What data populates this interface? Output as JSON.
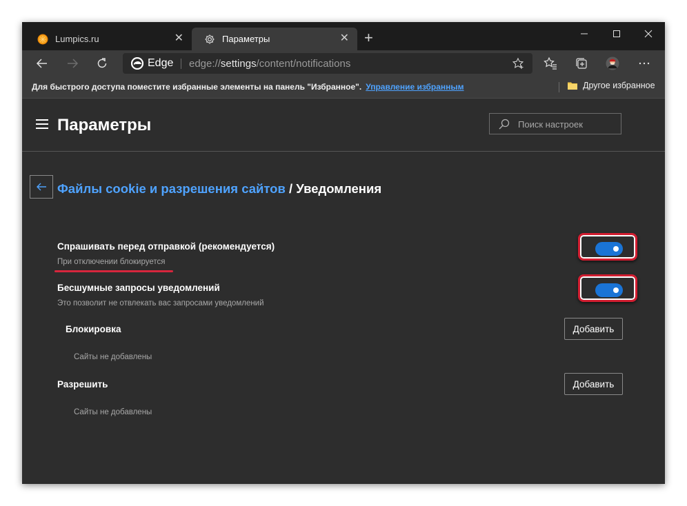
{
  "tabs": [
    {
      "label": "Lumpics.ru",
      "active": false
    },
    {
      "label": "Параметры",
      "active": true
    }
  ],
  "address": {
    "browser_label": "Edge",
    "url_scheme": "edge://",
    "url_host": "settings",
    "url_path": "/content/notifications"
  },
  "favorites_bar": {
    "hint": "Для быстрого доступа поместите избранные элементы на панель \"Избранное\".",
    "manage_link": "Управление избранным",
    "other_favorites": "Другое избранное"
  },
  "settings": {
    "title": "Параметры",
    "search_placeholder": "Поиск настроек"
  },
  "breadcrumb": {
    "parent": "Файлы cookie и разрешения сайтов",
    "separator": " / ",
    "current": "Уведомления"
  },
  "options": [
    {
      "title": "Спрашивать перед отправкой (рекомендуется)",
      "description": "При отключении блокируется",
      "enabled": true
    },
    {
      "title": "Бесшумные запросы уведомлений",
      "description": "Это позволит не отвлекать вас запросами уведомлений",
      "enabled": true
    }
  ],
  "sections": [
    {
      "title": "Блокировка",
      "button": "Добавить",
      "empty_text": "Сайты не добавлены"
    },
    {
      "title": "Разрешить",
      "button": "Добавить",
      "empty_text": "Сайты не добавлены"
    }
  ],
  "colors": {
    "accent": "#1a74d6",
    "link": "#4fa3ff",
    "highlight": "#d21d30",
    "background": "#2d2d2d"
  },
  "icons": [
    "lumpics-favicon-icon",
    "gear-icon",
    "close-icon",
    "plus-icon",
    "minimize-icon",
    "maximize-icon",
    "back-arrow-icon",
    "forward-arrow-icon",
    "refresh-icon",
    "edge-logo-icon",
    "star-add-icon",
    "favorites-icon",
    "collections-icon",
    "profile-avatar-icon",
    "more-icon",
    "folder-icon",
    "hamburger-menu-icon",
    "search-icon"
  ]
}
